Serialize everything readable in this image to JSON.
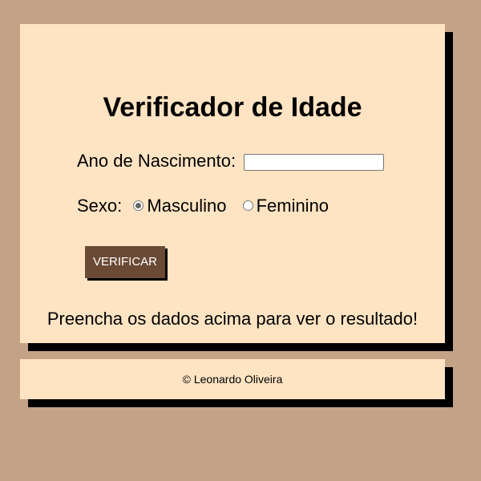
{
  "main": {
    "title": "Verificador de Idade",
    "year_label": "Ano de Nascimento:",
    "year_input": {
      "value": "",
      "placeholder": ""
    },
    "sex_label": "Sexo:",
    "sex_options": [
      {
        "label": "Masculino",
        "checked": true
      },
      {
        "label": "Feminino",
        "checked": false
      }
    ],
    "button_label": "VERIFICAR",
    "result_text": "Preencha os dados acima para ver o resultado!"
  },
  "footer": {
    "text": "© Leonardo Oliveira"
  },
  "colors": {
    "page_background": "#c4a286",
    "card_background": "#ffe4c3",
    "button_background": "#6b4a35",
    "shadow": "#000000"
  }
}
